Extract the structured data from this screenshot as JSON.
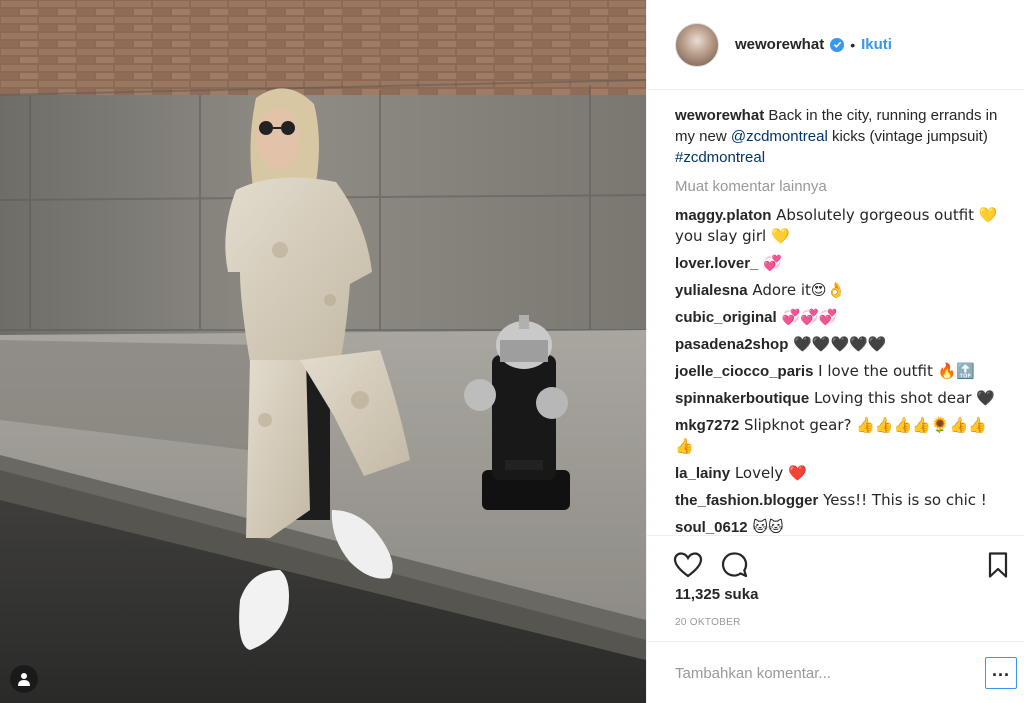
{
  "post": {
    "username": "weworewhat",
    "follow_label": "Ikuti",
    "separator": "•",
    "caption": {
      "user": "weworewhat",
      "text_before": " Back in the city, running errands in my new ",
      "mention": "@zcdmontreal",
      "text_middle": " kicks (vintage jumpsuit) ",
      "hashtag": "#zcdmontreal"
    },
    "load_more": "Muat komentar lainnya",
    "comments": [
      {
        "user": "maggy.platon",
        "text": " Absolutely gorgeous outfit 💛 you slay girl 💛"
      },
      {
        "user": "lover.lover_",
        "text": " 💞"
      },
      {
        "user": "yulialesna",
        "text": " Adore it😍👌"
      },
      {
        "user": "cubic_original",
        "text": " 💞💞💞"
      },
      {
        "user": "pasadena2shop",
        "text": " 🖤🖤🖤🖤🖤"
      },
      {
        "user": "joelle_ciocco_paris",
        "text": " I love the outfit 🔥🔝"
      },
      {
        "user": "spinnakerboutique",
        "text": " Loving this shot dear 🖤"
      },
      {
        "user": "mkg7272",
        "text": " Slipknot gear? 👍👍👍👍🌻👍👍👍"
      },
      {
        "user": "la_lainy",
        "text": " Lovely ❤️"
      },
      {
        "user": "the_fashion.blogger",
        "text": " Yess!! This is so chic !"
      },
      {
        "user": "soul_0612",
        "text": " 🐱🐱"
      }
    ],
    "likes": "11,325 suka",
    "date": "20 OKTOBER",
    "add_comment_placeholder": "Tambahkan komentar...",
    "more_label": "..."
  },
  "icons": {
    "like": "heart-icon",
    "comment": "comment-bubble-icon",
    "save": "bookmark-icon",
    "verified": "verified-badge-icon",
    "user_tag": "user-tag-icon"
  },
  "colors": {
    "link": "#003569",
    "follow": "#3897f0",
    "muted": "#999999",
    "text": "#262626"
  }
}
